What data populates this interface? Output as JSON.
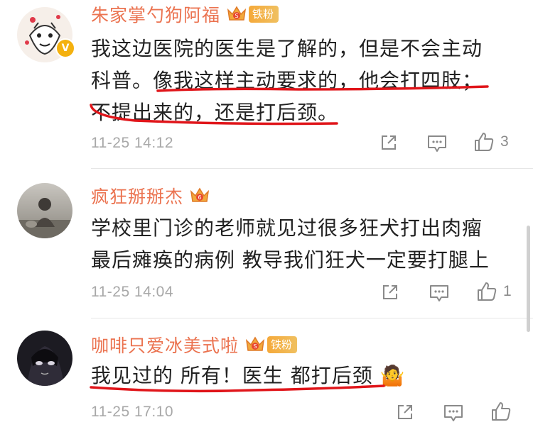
{
  "comments": [
    {
      "username": "朱家掌勺狗阿福",
      "fan_badge": "铁粉",
      "has_v_badge": true,
      "v_badge": "V",
      "lines": [
        "我这边医院的医生是了解的，但是不会主动",
        "科普。像我这样主动要求的，他会打四肢；",
        "不提出来的，还是打后颈。"
      ],
      "time": "11-25 14:12",
      "likes": "3"
    },
    {
      "username": "疯狂掰掰杰",
      "fan_badge": "",
      "has_v_badge": false,
      "lines": [
        "学校里门诊的老师就见过很多狂犬打出肉瘤",
        "最后瘫痪的病例 教导我们狂犬一定要打腿上"
      ],
      "time": "11-25 14:04",
      "likes": "1"
    },
    {
      "username": "咖啡只爱冰美式啦",
      "fan_badge": "铁粉",
      "has_v_badge": false,
      "lines": [
        "我见过的 所有！医生 都打后颈 🤷"
      ],
      "time": "11-25 17:10",
      "likes": ""
    }
  ],
  "icons": {
    "share": "share-icon",
    "comment": "comment-icon",
    "like": "thumbs-up-icon",
    "crown": "crown-icon",
    "shrug": "shrug-emoji"
  },
  "colors": {
    "username": "#eb7350",
    "annotation": "#e0151a",
    "meta": "#a8a8a8",
    "badge": "#f5a93a"
  }
}
